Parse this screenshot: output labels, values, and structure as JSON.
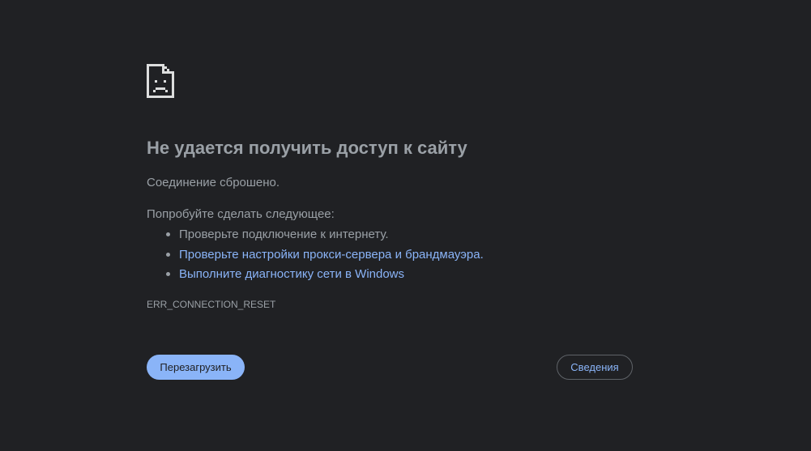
{
  "error": {
    "icon": "sad-document-icon",
    "title": "Не удается получить доступ к сайту",
    "summary": "Соединение сброшено.",
    "try_label": "Попробуйте сделать следующее:",
    "suggestions": [
      {
        "text": "Проверьте подключение к интернету.",
        "link": false
      },
      {
        "text": "Проверьте настройки прокси-сервера и брандмауэра.",
        "link": true
      },
      {
        "text": "Выполните диагностику сети в Windows",
        "link": true
      }
    ],
    "code": "ERR_CONNECTION_RESET"
  },
  "buttons": {
    "reload_label": "Перезагрузить",
    "details_label": "Сведения"
  },
  "colors": {
    "background": "#202124",
    "text": "#9aa0a6",
    "link": "#8ab4f8",
    "button_primary": "#8ab4f8"
  }
}
